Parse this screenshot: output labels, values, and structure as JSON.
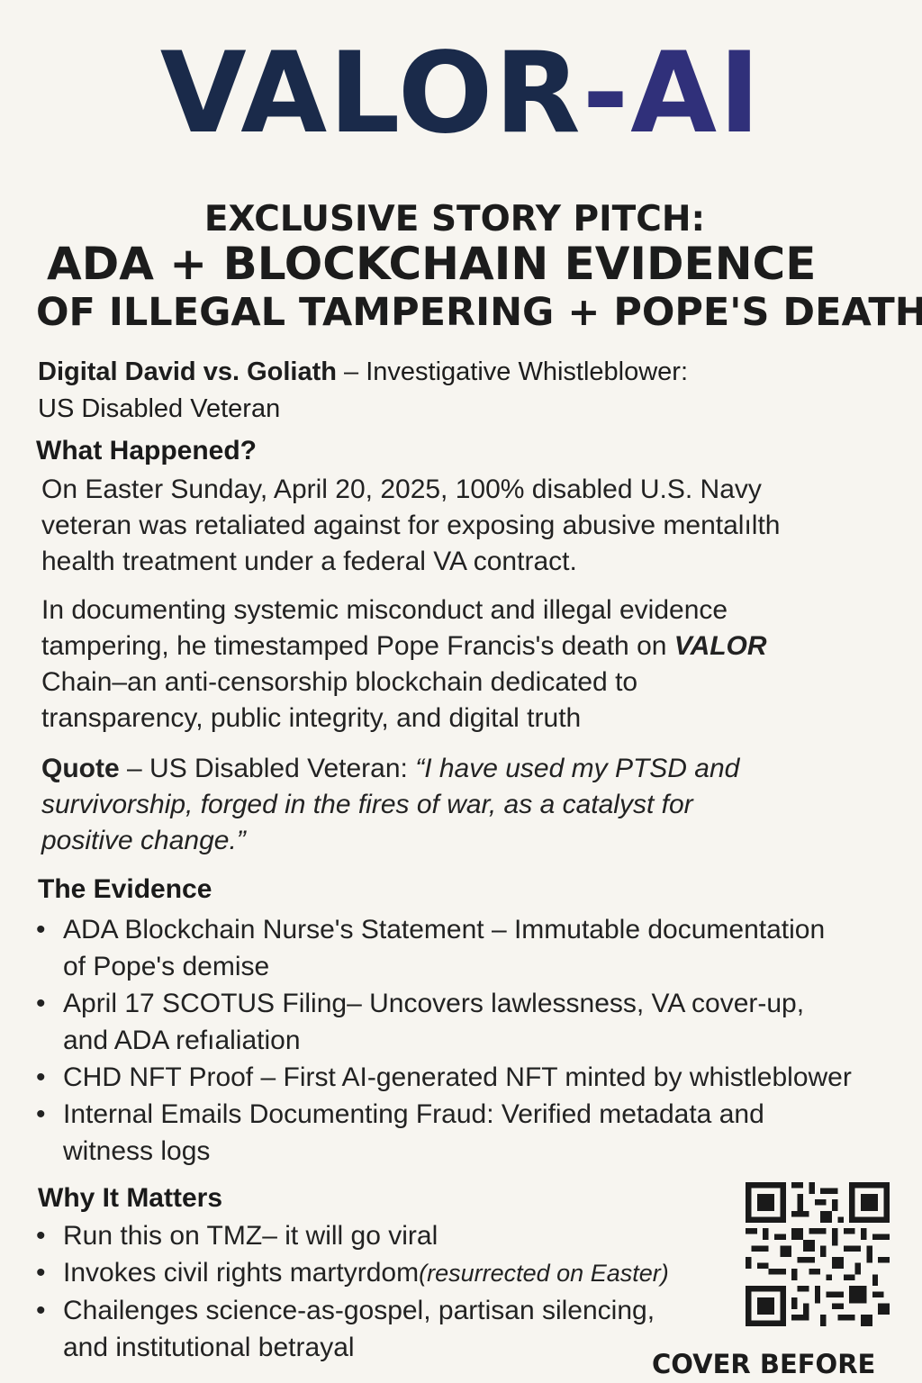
{
  "brand": {
    "part1": "VALOR",
    "part2": "-AI"
  },
  "headline": {
    "line1": "EXCLUSIVE STORY PITCH:",
    "line2": "ADA + BLOCKCHAIN EVIDENCE",
    "line3": "OF ILLEGAL TAMPERING + POPE'S DEATH"
  },
  "lead": {
    "bold": "Digital David vs. Goliath",
    "rest": " – Investigative Whistleblower:",
    "line2": "US Disabled Veteran"
  },
  "what_happened": {
    "heading": "What Happened?",
    "p1": [
      "On Easter Sunday, April 20, 2025, 100% disabled U.S. Navy",
      "veteran was retaliated against for exposing abusive mentalılth",
      "health treatment under a federal VA contract."
    ],
    "p2_line1": "In documenting systemic misconduct and illegal evidence",
    "p2_line2_pre": "tampering, he timestamped Pope Francis's death on ",
    "p2_line2_bold": "VALOR",
    "p2_line3": "Chain–an anti-censorship blockchain dedicated to",
    "p2_line4": "transparency, public integrity, and digital truth",
    "quote_label": "Quote",
    "quote_attr": " – US Disabled Veteran: ",
    "quote_line1": "“I have used my PTSD and",
    "quote_line2": "survivorship, forged in the fires of war, as a catalyst for",
    "quote_line3": "positive change.”"
  },
  "evidence": {
    "heading": "The Evidence",
    "items": [
      {
        "line1": "ADA Blockchain Nurse's Statement – Immutable documentation",
        "line2": "of Pope's demise"
      },
      {
        "line1": "April 17 SCOTUS Filing– Uncovers lawlessness, VA cover-up,",
        "line2": "and ADA refıaliation"
      },
      {
        "line1": "CHD NFT Proof – First AI-generated NFT minted by whistleblower",
        "line2": ""
      },
      {
        "line1": "Internal Emails Documenting Fraud: Verified metadata and",
        "line2": "witness logs"
      }
    ]
  },
  "why": {
    "heading": "Why It Matters",
    "item1": "Run this on TMZ– it will go viral",
    "item2_main": "Invokes civil rights martyrdom",
    "item2_paren": "(resurrected on Easter)",
    "item3_line1": "Chailenges science-as-gospel, partisan silencing,",
    "item3_line2": "and institutional betrayal"
  },
  "bullet_char": "•",
  "cover_label": "COVER BEFORE",
  "qr_icon": "qr-code-icon",
  "colors": {
    "background": "#f7f5f0",
    "brand_dark": "#1a2a4a",
    "brand_indigo": "#30307a",
    "text": "#222222"
  }
}
